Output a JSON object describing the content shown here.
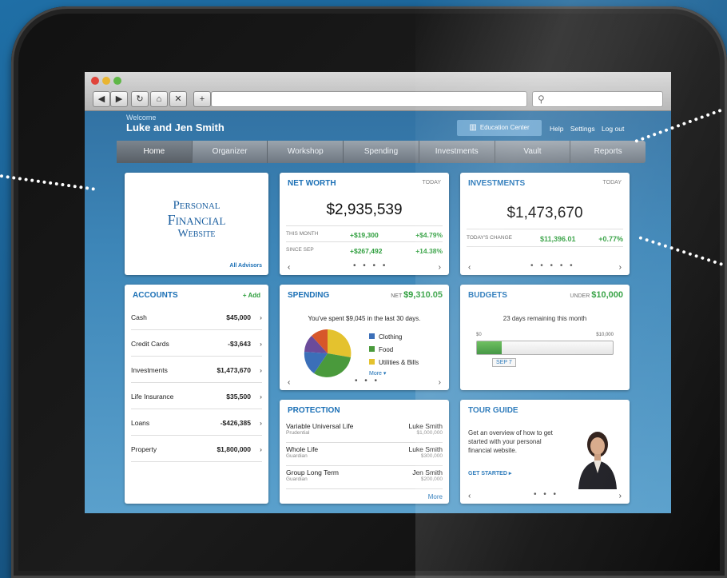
{
  "browser": {
    "back": "◀",
    "forward": "▶",
    "reload": "↻",
    "home": "⌂",
    "stop": "✕",
    "new_tab": "+",
    "search_icon": "⚲"
  },
  "header": {
    "welcome": "Welcome",
    "user_name": "Luke and Jen Smith",
    "education_center": "Education Center",
    "links": [
      "Help",
      "Settings",
      "Log out"
    ]
  },
  "nav": [
    "Home",
    "Organizer",
    "Workshop",
    "Spending",
    "Investments",
    "Vault",
    "Reports"
  ],
  "logo": {
    "line1": "Personal",
    "line2": "Financial",
    "line3": "Website",
    "all_advisors": "All Advisors"
  },
  "net_worth": {
    "title": "NET WORTH",
    "period": "TODAY",
    "amount": "$2,935,539",
    "rows": [
      {
        "label": "THIS MONTH",
        "value": "+$19,300",
        "pct": "+$4.79%"
      },
      {
        "label": "SINCE SEP",
        "value": "+$267,492",
        "pct": "+14.38%"
      }
    ],
    "dots": "• • • •"
  },
  "investments": {
    "title": "INVESTMENTS",
    "period": "TODAY",
    "amount": "$1,473,670",
    "change_label": "TODAY'S CHANGE",
    "change_value": "$11,396.01",
    "change_pct": "+0.77%",
    "dots": "• • • • •"
  },
  "accounts": {
    "title": "ACCOUNTS",
    "add": "+ Add",
    "items": [
      {
        "label": "Cash",
        "value": "$45,000"
      },
      {
        "label": "Credit Cards",
        "value": "-$3,643"
      },
      {
        "label": "Investments",
        "value": "$1,473,670"
      },
      {
        "label": "Life Insurance",
        "value": "$35,500"
      },
      {
        "label": "Loans",
        "value": "-$426,385"
      },
      {
        "label": "Property",
        "value": "$1,800,000"
      }
    ]
  },
  "spending": {
    "title": "SPENDING",
    "net_label": "NET",
    "net_value": "$9,310.05",
    "summary": "You've spent $9,045 in the last 30 days.",
    "legend": [
      "Clothing",
      "Food",
      "Utilities & Bills"
    ],
    "more": "More ▾",
    "dots": "• • •",
    "colors": [
      "#3b6fb8",
      "#4a9a3c",
      "#e4c22e",
      "#d7572a",
      "#6b4b9a"
    ]
  },
  "budgets": {
    "title": "BUDGETS",
    "under_label": "UNDER",
    "under_value": "$10,000",
    "remaining": "23 days remaining this month",
    "min": "$0",
    "max": "$10,000",
    "marker": "SEP 7",
    "progress_pct": 18
  },
  "protection": {
    "title": "PROTECTION",
    "items": [
      {
        "name": "Variable Universal Life",
        "company": "Prudential",
        "owner": "Luke Smith",
        "amount": "$1,000,000"
      },
      {
        "name": "Whole Life",
        "company": "Guardian",
        "owner": "Luke Smith",
        "amount": "$300,000"
      },
      {
        "name": "Group Long Term",
        "company": "Guardian",
        "owner": "Jen Smith",
        "amount": "$200,000"
      }
    ],
    "more": "More"
  },
  "tour": {
    "title": "TOUR GUIDE",
    "text": "Get an overview of how to get started with your personal financial website.",
    "cta": "GET STARTED ▸",
    "dots": "• • •"
  }
}
